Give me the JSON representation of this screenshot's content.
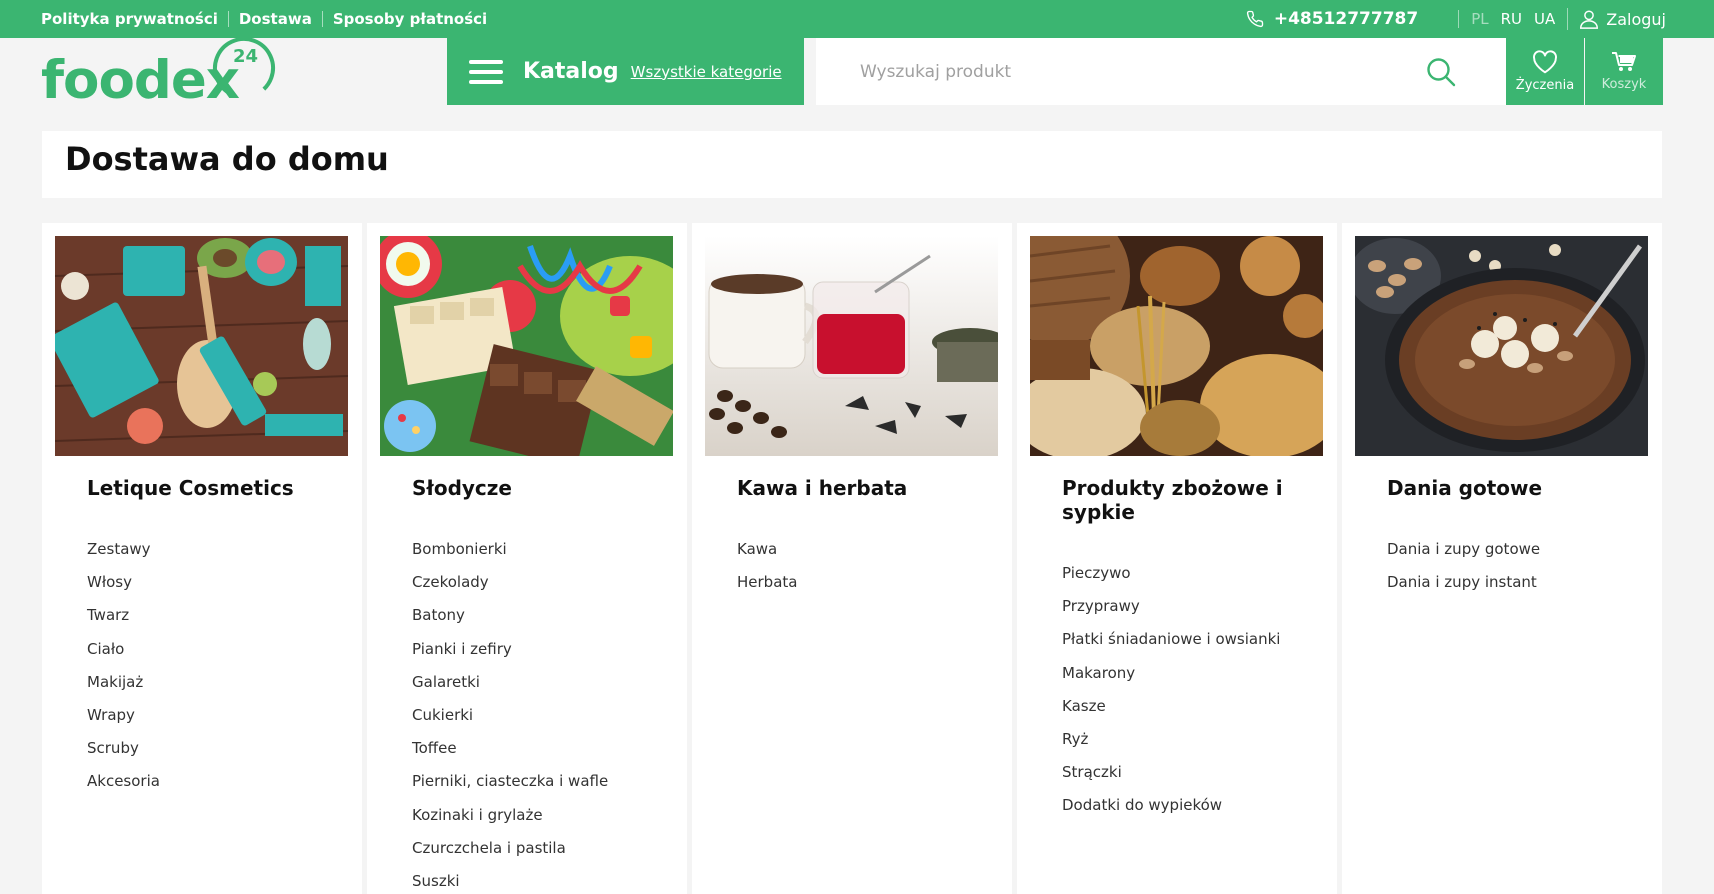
{
  "topbar": {
    "links": [
      "Polityka prywatności",
      "Dostawa",
      "Sposoby płatności"
    ],
    "phone": "+48512777787",
    "languages": [
      "PL",
      "RU",
      "UA"
    ],
    "login": "Zaloguj",
    "phone_icon": "phone-icon",
    "user_icon": "user-icon"
  },
  "logo": {
    "text": "foodex",
    "badge": "24"
  },
  "catalog": {
    "title": "Katalog",
    "link": "Wszystkie kategorie",
    "icon": "menu-icon"
  },
  "search": {
    "placeholder": "Wyszukaj produkt",
    "icon": "search-icon"
  },
  "wishlist": {
    "label": "Życzenia",
    "icon": "heart-icon"
  },
  "cart": {
    "label": "Koszyk",
    "icon": "cart-icon"
  },
  "page_title": "Dostawa do domu",
  "categories": [
    {
      "title": "Letique Cosmetics",
      "items": [
        "Zestawy",
        "Włosy",
        "Twarz",
        "Ciało",
        "Makijaż",
        "Wrapy",
        "Scruby",
        "Akcesoria"
      ]
    },
    {
      "title": "Słodycze",
      "items": [
        "Bombonierki",
        "Czekolady",
        "Batony",
        "Pianki i zefiry",
        "Galaretki",
        "Cukierki",
        "Toffee",
        "Pierniki, ciasteczka i wafle",
        "Kozinaki i grylaże",
        "Czurczchela i pastila",
        "Suszki"
      ]
    },
    {
      "title": "Kawa i herbata",
      "items": [
        "Kawa",
        "Herbata"
      ]
    },
    {
      "title": "Produkty zbożowe i sypkie",
      "items": [
        "Pieczywo",
        "Przyprawy",
        "Płatki śniadaniowe i owsianki",
        "Makarony",
        "Kasze",
        "Ryż",
        "Strączki",
        "Dodatki do wypieków"
      ]
    },
    {
      "title": "Dania gotowe",
      "items": [
        "Dania i zupy gotowe",
        "Dania i zupy instant"
      ]
    }
  ],
  "colors": {
    "brand_green": "#3bb571",
    "background": "#f4f4f4"
  }
}
